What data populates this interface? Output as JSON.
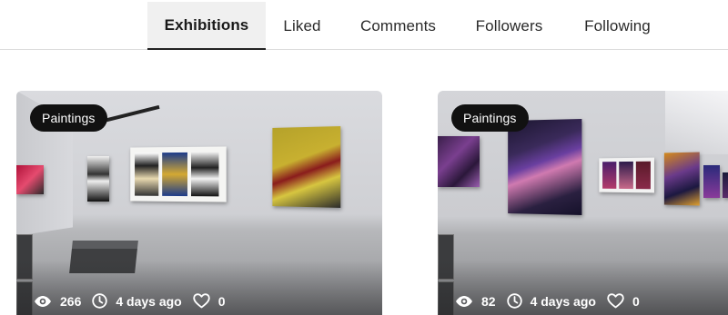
{
  "tabs": [
    {
      "label": "Exhibitions",
      "active": true
    },
    {
      "label": "Liked",
      "active": false
    },
    {
      "label": "Comments",
      "active": false
    },
    {
      "label": "Followers",
      "active": false
    },
    {
      "label": "Following",
      "active": false
    }
  ],
  "cards": [
    {
      "category": "Paintings",
      "views": "266",
      "time": "4 days ago",
      "likes": "0"
    },
    {
      "category": "Paintings",
      "views": "82",
      "time": "4 days ago",
      "likes": "0"
    }
  ],
  "icons": {
    "views": "eye-icon",
    "time": "clock-icon",
    "likes": "heart-icon"
  },
  "colors": {
    "badge_bg": "#111111",
    "active_tab_bg": "#f0f0f0",
    "stat_text": "#ffffff"
  }
}
